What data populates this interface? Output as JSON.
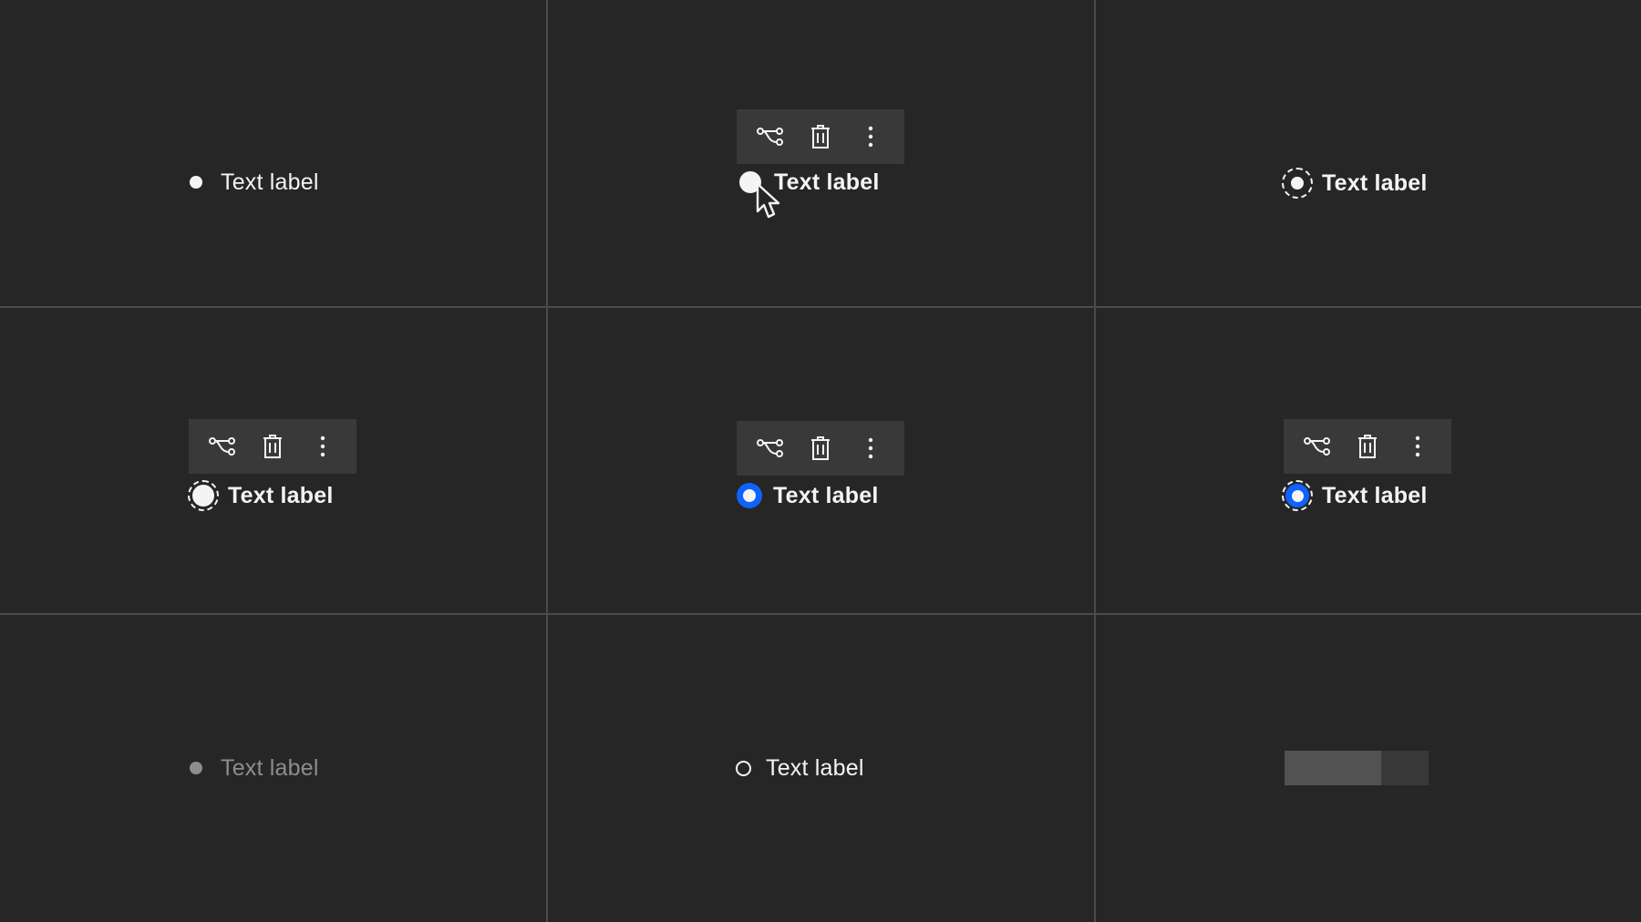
{
  "cells": {
    "default": {
      "label": "Text label"
    },
    "hover": {
      "label": "Text label"
    },
    "focus": {
      "label": "Text label"
    },
    "focus_hover": {
      "label": "Text label"
    },
    "selected": {
      "label": "Text label"
    },
    "selected_focus": {
      "label": "Text label"
    },
    "disabled": {
      "label": "Text label"
    },
    "unvisited": {
      "label": "Text label"
    },
    "skeleton": {
      "fill_fraction": 0.67
    }
  },
  "toolbar": {
    "icons": [
      "flow-icon",
      "trash-can-icon",
      "overflow-menu-vertical-icon"
    ]
  },
  "colors": {
    "background": "#262626",
    "grid_line": "#4a4a4a",
    "text": "#f4f4f4",
    "text_disabled": "#8d8d8d",
    "toolbar_bg": "#393939",
    "selected_accent": "#0f62fe",
    "skeleton_bg": "#393939",
    "skeleton_fill": "#525252"
  }
}
